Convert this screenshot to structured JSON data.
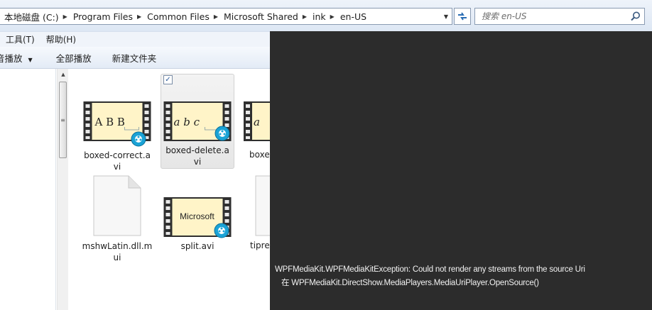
{
  "address_bar": {
    "crumbs": [
      "本地磁盘 (C:)",
      "Program Files",
      "Common Files",
      "Microsoft Shared",
      "ink",
      "en-US"
    ]
  },
  "search": {
    "placeholder": "搜索 en-US"
  },
  "menu": {
    "items": [
      "工具(T)",
      "帮助(H)"
    ]
  },
  "toolbar": {
    "play_to": "音播放",
    "play_all": "全部播放",
    "new_folder": "新建文件夹"
  },
  "files": [
    {
      "name": "boxed-correct.avi",
      "name_lines": [
        "boxed-correct.a",
        "vi"
      ],
      "type": "video",
      "thumb_text": "A B B"
    },
    {
      "name": "boxed-delete.avi",
      "name_lines": [
        "boxed-delete.a",
        "vi"
      ],
      "type": "video",
      "thumb_text": "a b c",
      "selected": true,
      "checked": true
    },
    {
      "name": "boxe",
      "name_lines": [
        "boxe"
      ],
      "type": "video",
      "thumb_text": "a"
    },
    {
      "name": "mshwLatin.dll.mui",
      "name_lines": [
        "mshwLatin.dll.m",
        "ui"
      ],
      "type": "document"
    },
    {
      "name": "split.avi",
      "name_lines": [
        "split.avi"
      ],
      "type": "video",
      "thumb_text": "Microsoft"
    },
    {
      "name": "tipre",
      "name_lines": [
        "tipre"
      ],
      "type": "document"
    }
  ],
  "error_overlay": {
    "line1": "WPFMediaKit.WPFMediaKitException: Could not render any streams from the source Uri",
    "line2": "在 WPFMediaKit.DirectShow.MediaPlayers.MediaUriPlayer.OpenSource()"
  },
  "colors": {
    "overlay": "#2c2c2c",
    "film": "#2f2f2f",
    "frame": "#fff4c8",
    "accent": "#2a6db4"
  }
}
